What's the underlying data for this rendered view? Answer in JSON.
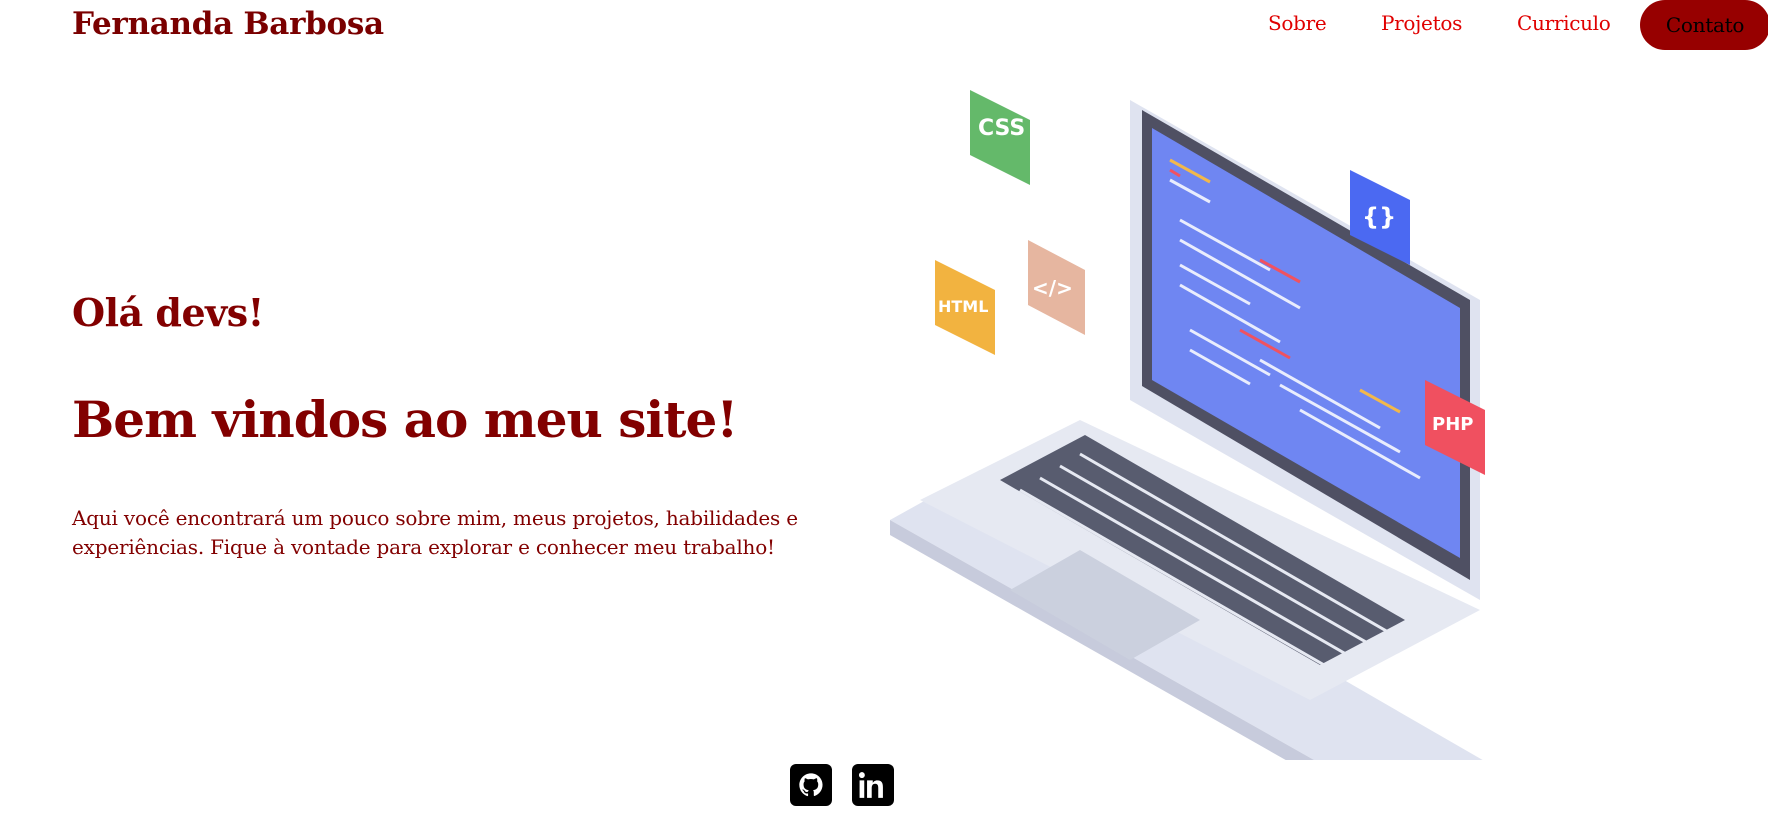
{
  "header": {
    "brand": "Fernanda Barbosa",
    "nav": {
      "sobre": "Sobre",
      "projetos": "Projetos",
      "curriculo": "Curriculo",
      "contato": "Contato"
    }
  },
  "hero": {
    "greeting": "Olá devs!",
    "title": "Bem vindos ao meu site!",
    "description": "Aqui você encontrará um pouco sobre mim, meus projetos, habilidades e experiências. Fique à vontade para explorar e conhecer meu trabalho!",
    "illustration": {
      "badges": [
        "CSS",
        "HTML",
        "</>",
        "{}",
        "PHP"
      ],
      "icon": "laptop-code-illustration"
    }
  },
  "social": {
    "github_icon": "github-icon",
    "linkedin_icon": "linkedin-icon"
  },
  "colors": {
    "primary": "#820000",
    "nav_link": "#e00000",
    "contact_bg": "#970000"
  }
}
